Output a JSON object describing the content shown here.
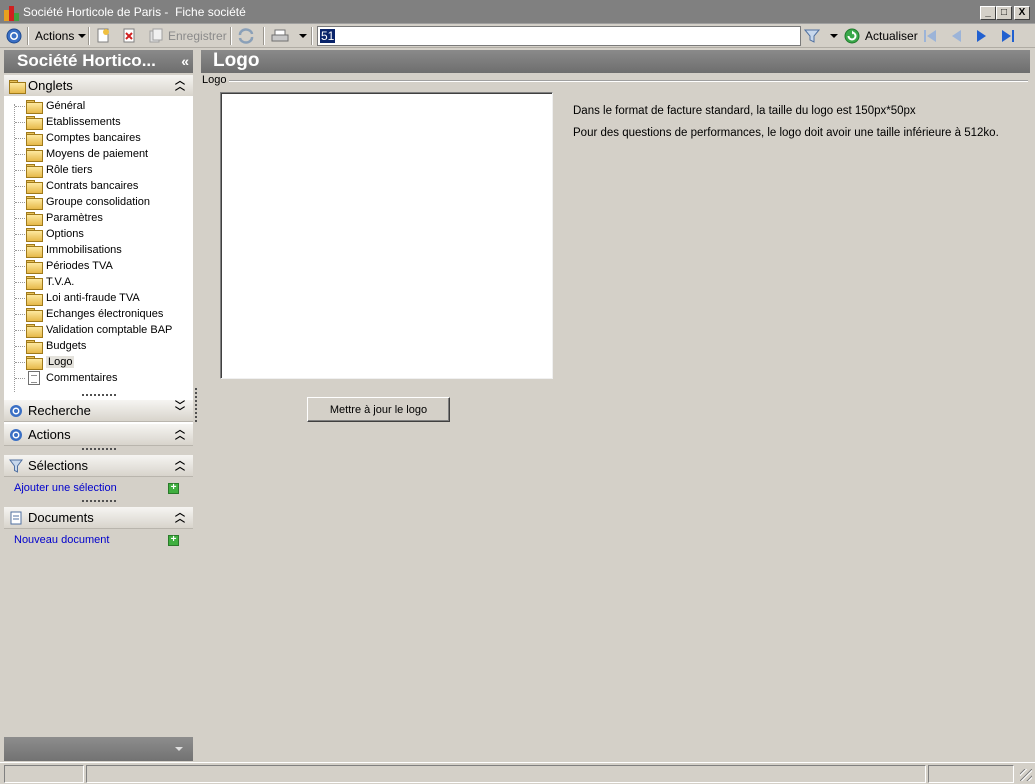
{
  "window": {
    "title": "Société Horticole de Paris -  Fiche société",
    "minimize_label": "_",
    "maximize_label": "□",
    "close_label": "X"
  },
  "toolbar": {
    "actions_label": "Actions",
    "save_label": "Enregistrer",
    "search_value": "51",
    "refresh_label": "Actualiser"
  },
  "sidebar": {
    "company_title": "Société Hortico...",
    "collapse_glyph": "«",
    "tabs_panel": {
      "title": "Onglets",
      "items": [
        {
          "label": "Général"
        },
        {
          "label": "Etablissements"
        },
        {
          "label": "Comptes bancaires"
        },
        {
          "label": "Moyens de paiement"
        },
        {
          "label": "Rôle tiers"
        },
        {
          "label": "Contrats bancaires"
        },
        {
          "label": "Groupe consolidation"
        },
        {
          "label": "Paramètres"
        },
        {
          "label": "Options"
        },
        {
          "label": "Immobilisations"
        },
        {
          "label": "Périodes TVA"
        },
        {
          "label": "T.V.A."
        },
        {
          "label": "Loi anti-fraude TVA"
        },
        {
          "label": "Echanges électroniques"
        },
        {
          "label": "Validation comptable BAP"
        },
        {
          "label": "Budgets"
        },
        {
          "label": "Logo",
          "selected": true
        },
        {
          "label": "Commentaires"
        }
      ]
    },
    "search_panel": {
      "title": "Recherche"
    },
    "actions_panel": {
      "title": "Actions"
    },
    "selections_panel": {
      "title": "Sélections",
      "add_link": "Ajouter une sélection"
    },
    "documents_panel": {
      "title": "Documents",
      "add_link": "Nouveau document"
    }
  },
  "main": {
    "title": "Logo",
    "group_label": "Logo",
    "info_line_1": "Dans le format de facture standard, la taille du logo est 150px*50px",
    "info_line_2": "Pour des questions de performances, le logo doit avoir une taille inférieure à 512ko.",
    "update_button": "Mettre à jour le logo"
  },
  "colors": {
    "header_gray": "#7c7c7c",
    "background": "#d4d0c8",
    "link_blue": "#0000cc"
  }
}
